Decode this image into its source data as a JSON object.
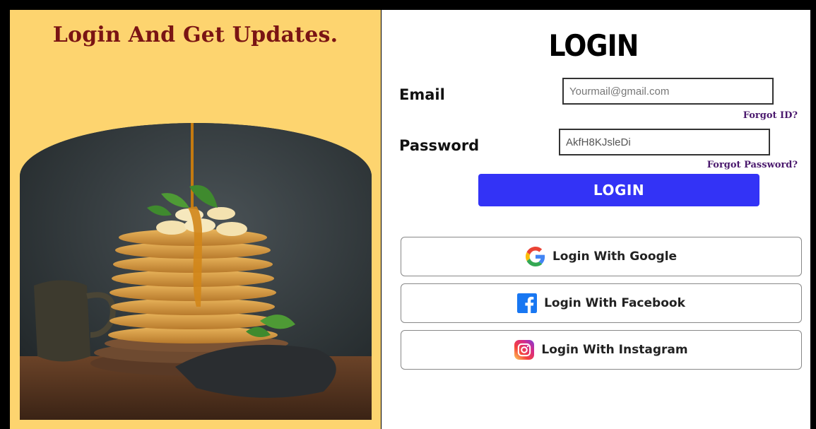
{
  "promo": {
    "title": "Login And Get Updates."
  },
  "login": {
    "heading": "LOGIN",
    "email_label": "Email",
    "email_placeholder": "Yourmail@gmail.com",
    "password_label": "Password",
    "password_value": "AkfH8KJsleDi",
    "forgot_id": "Forgot ID?",
    "forgot_password": "Forgot Password?",
    "submit_label": "LOGIN"
  },
  "social": {
    "google_label": "Login With Google",
    "facebook_label": "Login With Facebook",
    "instagram_label": "Login With Instagram"
  },
  "colors": {
    "promo_bg": "#fdd46f",
    "promo_title": "#7a1414",
    "login_button": "#3333f6",
    "forgot_link": "#4b1a6e"
  },
  "icons": {
    "google": "google-icon",
    "facebook": "facebook-icon",
    "instagram": "instagram-icon"
  }
}
